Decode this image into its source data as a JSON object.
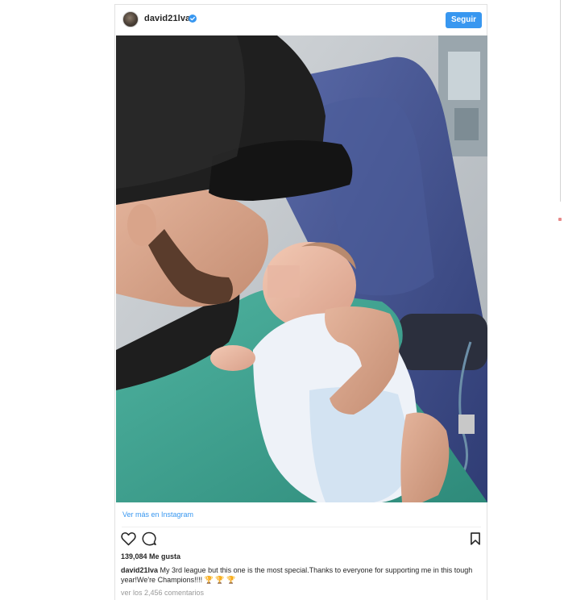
{
  "post": {
    "username": "david21lva",
    "follow_label": "Seguir",
    "view_more_label": "Ver más en Instagram",
    "likes_text": "139,084 Me gusta",
    "caption_user": "david21lva",
    "caption_text": " My 3rd league but this one is the most special.Thanks to everyone for supporting me in this tough year!We're Champions!!!! 🏆 🏆 🏆",
    "comments_text": "ver los 2,456 comentarios"
  },
  "icons": {
    "verified": "verified-badge-icon",
    "like": "heart-icon",
    "comment": "comment-bubble-icon",
    "save": "bookmark-icon"
  },
  "colors": {
    "accent": "#3897f0",
    "text": "#262626",
    "muted": "#999999"
  }
}
